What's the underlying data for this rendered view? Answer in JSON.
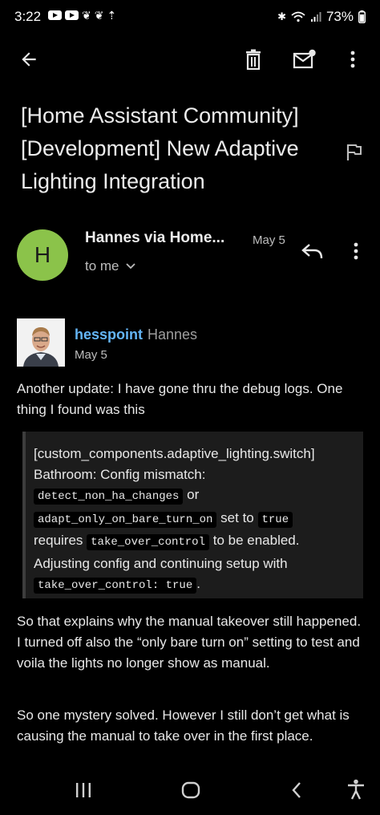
{
  "status_bar": {
    "time": "3:22",
    "battery": "73%"
  },
  "email": {
    "subject": "[Home Assistant Community] [Development] New Adaptive Lighting Integration",
    "sender": {
      "initial": "H",
      "name": "Hannes via Home...",
      "date": "May 5",
      "recipient": "to me",
      "avatar_color": "#8bc34a"
    }
  },
  "post": {
    "username": "hesspoint",
    "display_name": "Hannes",
    "date": "May 5",
    "intro": "Another update: I have gone thru the debug logs. One thing I found was this",
    "quote": {
      "line1": "[custom_components.adaptive_lighting.switch]",
      "line2": "Bathroom: Config mismatch:",
      "code1": "detect_non_ha_changes",
      "or": "or",
      "code2": "adapt_only_on_bare_turn_on",
      "set_to": "set to",
      "code3": "true",
      "requires": "requires",
      "code4": "take_over_control",
      "to_be_enabled": "to be enabled.",
      "line_adjust": "Adjusting config and continuing setup with",
      "code5": "take_over_control: true",
      "period": "."
    },
    "paragraph2": "So that explains why the manual takeover still happened. I turned off also the “only bare turn on” setting to test and voila the lights no longer show as manual.",
    "paragraph3": "So one mystery solved. However I still don’t get what is causing the manual to take over in the first place."
  },
  "colors": {
    "background": "#000000",
    "quote_bg": "#1c1c1c",
    "username": "#64b5f6",
    "text": "#e8e8e8"
  }
}
